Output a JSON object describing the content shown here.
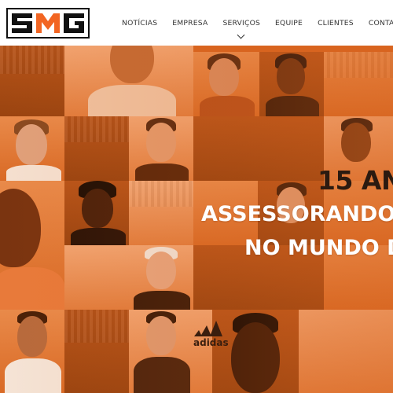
{
  "brand": {
    "logo_text": "SMG",
    "accent": "#f26522",
    "logo_dark": "#111111"
  },
  "nav": {
    "items": [
      {
        "label": "NOTÍCIAS"
      },
      {
        "label": "EMPRESA"
      },
      {
        "label": "SERVIÇOS",
        "has_dropdown": true
      },
      {
        "label": "EQUIPE"
      },
      {
        "label": "CLIENTES"
      },
      {
        "label": "CONTATO"
      }
    ]
  },
  "hero": {
    "headline_1": "15 AN",
    "headline_2": "ASSESSORANDO",
    "headline_3": "NO MUNDO D",
    "sponsor_text": "adidas",
    "overlay_color": "#d8641f"
  }
}
